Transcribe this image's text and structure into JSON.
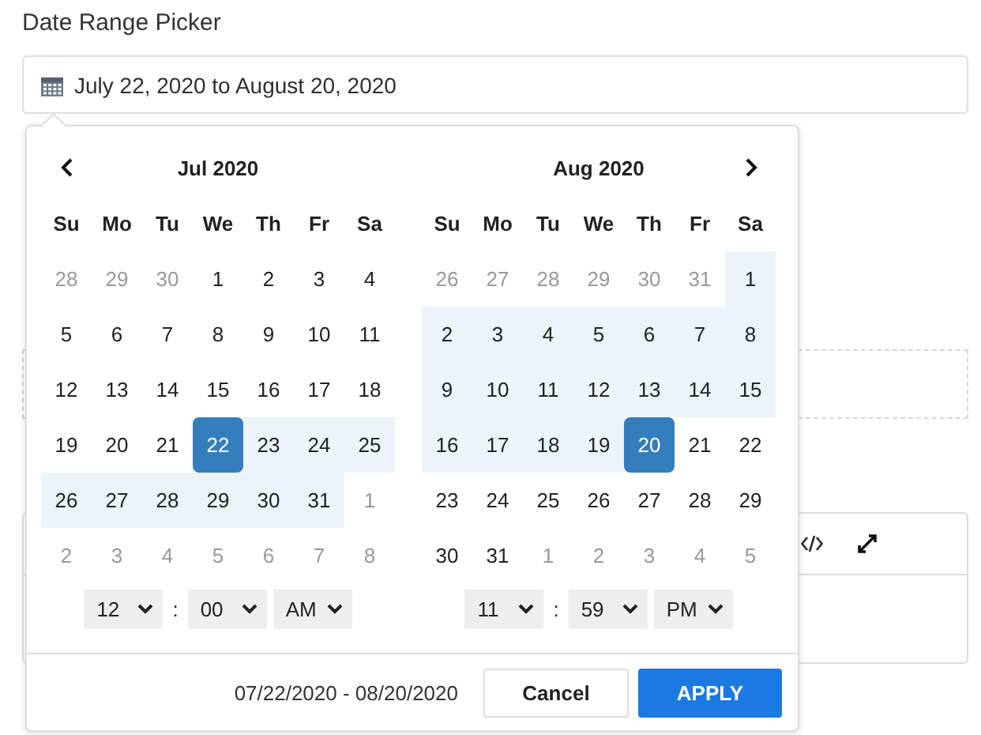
{
  "field_label": "Date Range Picker",
  "date_field": {
    "value": "July 22, 2020 to August 20, 2020"
  },
  "picker": {
    "calendars": [
      {
        "title": "Jul 2020",
        "prev_arrow": true,
        "next_arrow": false,
        "weekdays": [
          "Su",
          "Mo",
          "Tu",
          "We",
          "Th",
          "Fr",
          "Sa"
        ],
        "weeks": [
          [
            {
              "day": "28",
              "muted": true,
              "in_range": false,
              "selected": false
            },
            {
              "day": "29",
              "muted": true,
              "in_range": false,
              "selected": false
            },
            {
              "day": "30",
              "muted": true,
              "in_range": false,
              "selected": false
            },
            {
              "day": "1",
              "muted": false,
              "in_range": false,
              "selected": false
            },
            {
              "day": "2",
              "muted": false,
              "in_range": false,
              "selected": false
            },
            {
              "day": "3",
              "muted": false,
              "in_range": false,
              "selected": false
            },
            {
              "day": "4",
              "muted": false,
              "in_range": false,
              "selected": false
            }
          ],
          [
            {
              "day": "5",
              "muted": false,
              "in_range": false,
              "selected": false
            },
            {
              "day": "6",
              "muted": false,
              "in_range": false,
              "selected": false
            },
            {
              "day": "7",
              "muted": false,
              "in_range": false,
              "selected": false
            },
            {
              "day": "8",
              "muted": false,
              "in_range": false,
              "selected": false
            },
            {
              "day": "9",
              "muted": false,
              "in_range": false,
              "selected": false
            },
            {
              "day": "10",
              "muted": false,
              "in_range": false,
              "selected": false
            },
            {
              "day": "11",
              "muted": false,
              "in_range": false,
              "selected": false
            }
          ],
          [
            {
              "day": "12",
              "muted": false,
              "in_range": false,
              "selected": false
            },
            {
              "day": "13",
              "muted": false,
              "in_range": false,
              "selected": false
            },
            {
              "day": "14",
              "muted": false,
              "in_range": false,
              "selected": false
            },
            {
              "day": "15",
              "muted": false,
              "in_range": false,
              "selected": false
            },
            {
              "day": "16",
              "muted": false,
              "in_range": false,
              "selected": false
            },
            {
              "day": "17",
              "muted": false,
              "in_range": false,
              "selected": false
            },
            {
              "day": "18",
              "muted": false,
              "in_range": false,
              "selected": false
            }
          ],
          [
            {
              "day": "19",
              "muted": false,
              "in_range": false,
              "selected": false
            },
            {
              "day": "20",
              "muted": false,
              "in_range": false,
              "selected": false
            },
            {
              "day": "21",
              "muted": false,
              "in_range": false,
              "selected": false
            },
            {
              "day": "22",
              "muted": false,
              "in_range": true,
              "selected": true
            },
            {
              "day": "23",
              "muted": false,
              "in_range": true,
              "selected": false
            },
            {
              "day": "24",
              "muted": false,
              "in_range": true,
              "selected": false
            },
            {
              "day": "25",
              "muted": false,
              "in_range": true,
              "selected": false
            }
          ],
          [
            {
              "day": "26",
              "muted": false,
              "in_range": true,
              "selected": false
            },
            {
              "day": "27",
              "muted": false,
              "in_range": true,
              "selected": false
            },
            {
              "day": "28",
              "muted": false,
              "in_range": true,
              "selected": false
            },
            {
              "day": "29",
              "muted": false,
              "in_range": true,
              "selected": false
            },
            {
              "day": "30",
              "muted": false,
              "in_range": true,
              "selected": false
            },
            {
              "day": "31",
              "muted": false,
              "in_range": true,
              "selected": false
            },
            {
              "day": "1",
              "muted": true,
              "in_range": false,
              "selected": false
            }
          ],
          [
            {
              "day": "2",
              "muted": true,
              "in_range": false,
              "selected": false
            },
            {
              "day": "3",
              "muted": true,
              "in_range": false,
              "selected": false
            },
            {
              "day": "4",
              "muted": true,
              "in_range": false,
              "selected": false
            },
            {
              "day": "5",
              "muted": true,
              "in_range": false,
              "selected": false
            },
            {
              "day": "6",
              "muted": true,
              "in_range": false,
              "selected": false
            },
            {
              "day": "7",
              "muted": true,
              "in_range": false,
              "selected": false
            },
            {
              "day": "8",
              "muted": true,
              "in_range": false,
              "selected": false
            }
          ]
        ],
        "time": {
          "hour": "12",
          "minute": "00",
          "period": "AM"
        }
      },
      {
        "title": "Aug 2020",
        "prev_arrow": false,
        "next_arrow": true,
        "weekdays": [
          "Su",
          "Mo",
          "Tu",
          "We",
          "Th",
          "Fr",
          "Sa"
        ],
        "weeks": [
          [
            {
              "day": "26",
              "muted": true,
              "in_range": false,
              "selected": false
            },
            {
              "day": "27",
              "muted": true,
              "in_range": false,
              "selected": false
            },
            {
              "day": "28",
              "muted": true,
              "in_range": false,
              "selected": false
            },
            {
              "day": "29",
              "muted": true,
              "in_range": false,
              "selected": false
            },
            {
              "day": "30",
              "muted": true,
              "in_range": false,
              "selected": false
            },
            {
              "day": "31",
              "muted": true,
              "in_range": false,
              "selected": false
            },
            {
              "day": "1",
              "muted": false,
              "in_range": true,
              "selected": false
            }
          ],
          [
            {
              "day": "2",
              "muted": false,
              "in_range": true,
              "selected": false
            },
            {
              "day": "3",
              "muted": false,
              "in_range": true,
              "selected": false
            },
            {
              "day": "4",
              "muted": false,
              "in_range": true,
              "selected": false
            },
            {
              "day": "5",
              "muted": false,
              "in_range": true,
              "selected": false
            },
            {
              "day": "6",
              "muted": false,
              "in_range": true,
              "selected": false
            },
            {
              "day": "7",
              "muted": false,
              "in_range": true,
              "selected": false
            },
            {
              "day": "8",
              "muted": false,
              "in_range": true,
              "selected": false
            }
          ],
          [
            {
              "day": "9",
              "muted": false,
              "in_range": true,
              "selected": false
            },
            {
              "day": "10",
              "muted": false,
              "in_range": true,
              "selected": false
            },
            {
              "day": "11",
              "muted": false,
              "in_range": true,
              "selected": false
            },
            {
              "day": "12",
              "muted": false,
              "in_range": true,
              "selected": false
            },
            {
              "day": "13",
              "muted": false,
              "in_range": true,
              "selected": false
            },
            {
              "day": "14",
              "muted": false,
              "in_range": true,
              "selected": false
            },
            {
              "day": "15",
              "muted": false,
              "in_range": true,
              "selected": false
            }
          ],
          [
            {
              "day": "16",
              "muted": false,
              "in_range": true,
              "selected": false
            },
            {
              "day": "17",
              "muted": false,
              "in_range": true,
              "selected": false
            },
            {
              "day": "18",
              "muted": false,
              "in_range": true,
              "selected": false
            },
            {
              "day": "19",
              "muted": false,
              "in_range": true,
              "selected": false
            },
            {
              "day": "20",
              "muted": false,
              "in_range": true,
              "selected": true
            },
            {
              "day": "21",
              "muted": false,
              "in_range": false,
              "selected": false
            },
            {
              "day": "22",
              "muted": false,
              "in_range": false,
              "selected": false
            }
          ],
          [
            {
              "day": "23",
              "muted": false,
              "in_range": false,
              "selected": false
            },
            {
              "day": "24",
              "muted": false,
              "in_range": false,
              "selected": false
            },
            {
              "day": "25",
              "muted": false,
              "in_range": false,
              "selected": false
            },
            {
              "day": "26",
              "muted": false,
              "in_range": false,
              "selected": false
            },
            {
              "day": "27",
              "muted": false,
              "in_range": false,
              "selected": false
            },
            {
              "day": "28",
              "muted": false,
              "in_range": false,
              "selected": false
            },
            {
              "day": "29",
              "muted": false,
              "in_range": false,
              "selected": false
            }
          ],
          [
            {
              "day": "30",
              "muted": false,
              "in_range": false,
              "selected": false
            },
            {
              "day": "31",
              "muted": false,
              "in_range": false,
              "selected": false
            },
            {
              "day": "1",
              "muted": true,
              "in_range": false,
              "selected": false
            },
            {
              "day": "2",
              "muted": true,
              "in_range": false,
              "selected": false
            },
            {
              "day": "3",
              "muted": true,
              "in_range": false,
              "selected": false
            },
            {
              "day": "4",
              "muted": true,
              "in_range": false,
              "selected": false
            },
            {
              "day": "5",
              "muted": true,
              "in_range": false,
              "selected": false
            }
          ]
        ],
        "time": {
          "hour": "11",
          "minute": "59",
          "period": "PM"
        }
      }
    ],
    "time_separator": ":",
    "range_text": "07/22/2020 - 08/20/2020",
    "buttons": [
      {
        "label": "Cancel",
        "kind": "cancel"
      },
      {
        "label": "APPLY",
        "kind": "apply"
      }
    ]
  }
}
